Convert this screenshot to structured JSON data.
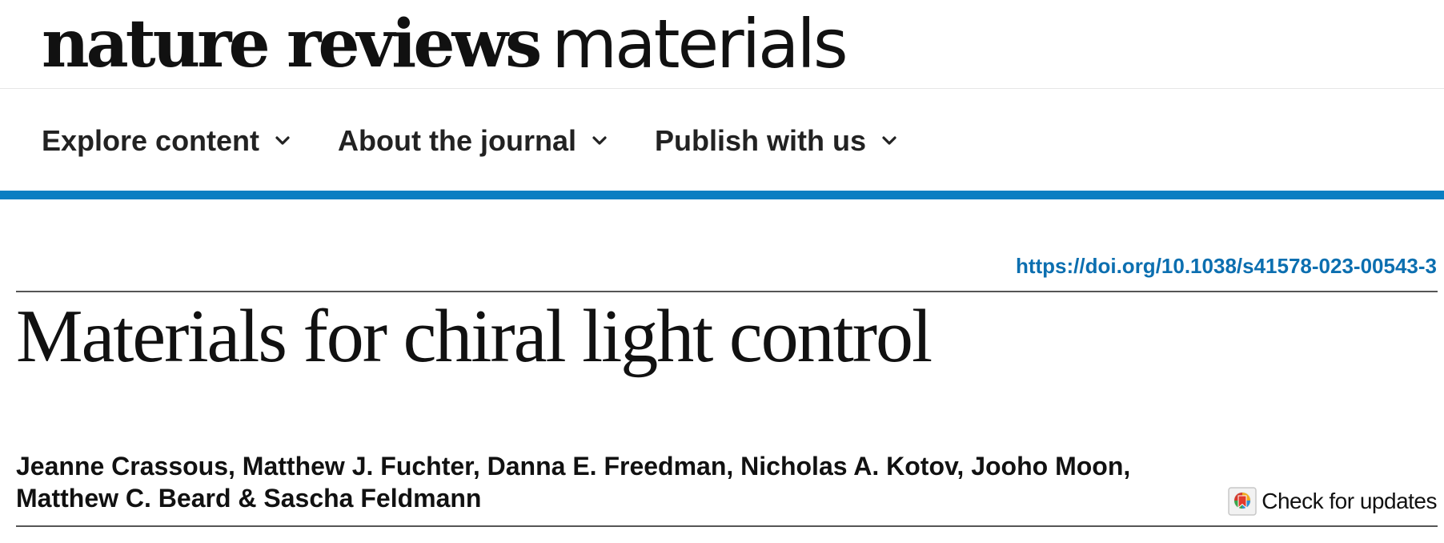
{
  "header": {
    "logo_bold": "nature reviews",
    "logo_light": "materials"
  },
  "nav": {
    "items": [
      {
        "label": "Explore content",
        "icon": "chevron-down-icon"
      },
      {
        "label": "About the journal",
        "icon": "chevron-down-icon"
      },
      {
        "label": "Publish with us",
        "icon": "chevron-down-icon"
      }
    ]
  },
  "colors": {
    "accent_bar": "#0a7ec2",
    "doi_link": "#0c6fb0",
    "text": "#111111"
  },
  "article": {
    "doi": "https://doi.org/10.1038/s41578-023-00543-3",
    "title": "Materials for chiral light control",
    "authors_line1": "Jeanne Crassous, Matthew J. Fuchter, Danna E. Freedman, Nicholas A. Kotov, Jooho Moon,",
    "authors_line2": "Matthew C. Beard & Sascha Feldmann",
    "check_updates": {
      "label": "Check for updates",
      "icon": "check-for-updates-icon"
    }
  }
}
